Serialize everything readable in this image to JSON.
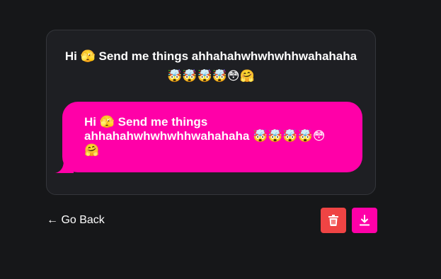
{
  "card": {
    "title": "Hi 🫣 Send me things ahhahahwhwhwhhwahahaha 🤯🤯🤯🤯😳🤗"
  },
  "bubble": {
    "text": "Hi 🫣 Send me things ahhahahwhwhwhhwahahaha 🤯🤯🤯🤯😳🤗",
    "color": "#ff00a8"
  },
  "footer": {
    "go_back_label": "← Go Back",
    "delete_icon": "trash-icon",
    "download_icon": "download-icon",
    "delete_color": "#ef4444",
    "download_color": "#ff00a8"
  }
}
